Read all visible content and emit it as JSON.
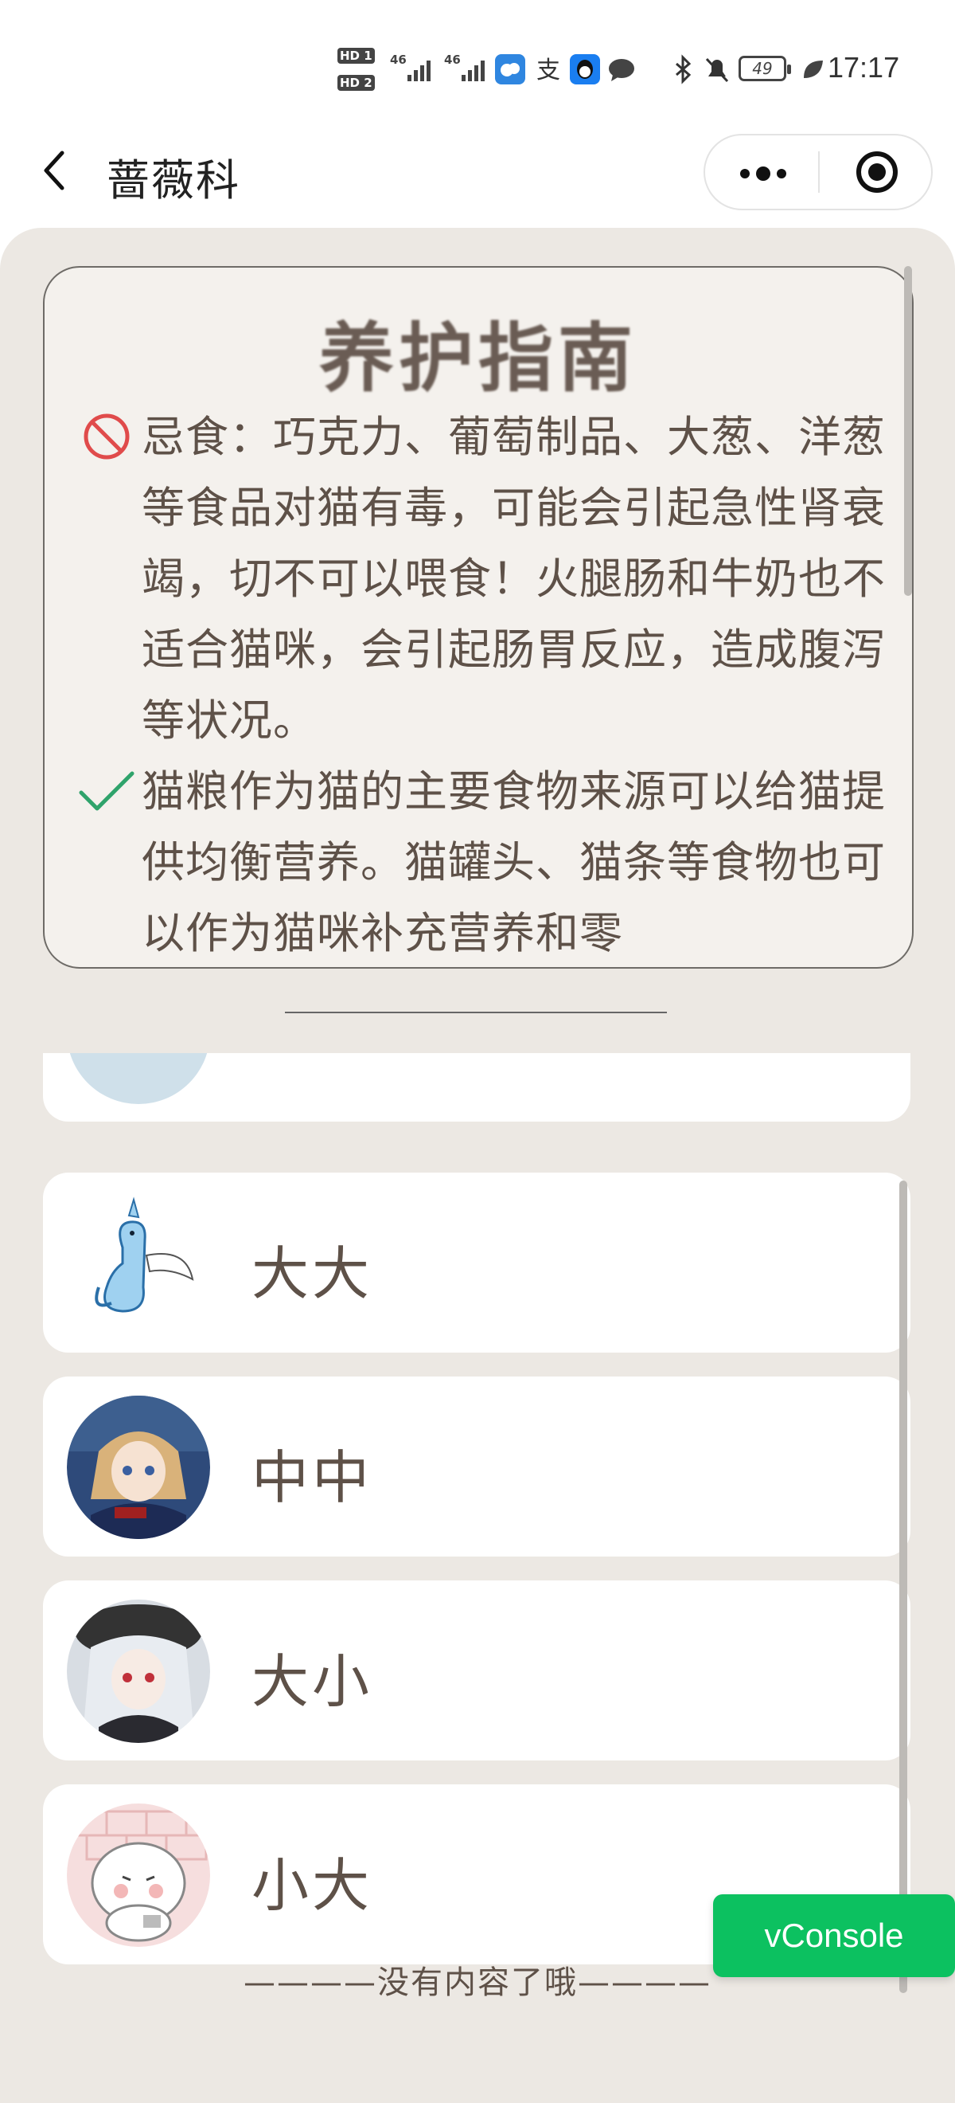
{
  "status_bar": {
    "time": "17:17",
    "battery": "49",
    "sim1": "HD 1",
    "sim2": "HD 2",
    "network1": "46",
    "network2": "46",
    "icons": [
      "weather-app-icon",
      "alipay-icon",
      "qq-icon",
      "chat-bubble-icon",
      "bluetooth-icon",
      "mute-bell-icon",
      "leaf-icon"
    ]
  },
  "nav": {
    "title": "蔷薇科"
  },
  "guide": {
    "title": "养护指南",
    "warning_text": "忌食：巧克力、葡萄制品、大葱、洋葱等食品对猫有毒，可能会引起急性肾衰竭，切不可以喂食！火腿肠和牛奶也不适合猫咪，会引起肠胃反应，造成腹泻等状况。",
    "recommend_text": "猫粮作为猫的主要食物来源可以给猫提供均衡营养。猫罐头、猫条等食物也可以作为猫咪补充营养和零"
  },
  "pets": [
    {
      "name": "大大",
      "avatar": "blue-dragon-avatar"
    },
    {
      "name": "中中",
      "avatar": "anime-girl-blonde-avatar"
    },
    {
      "name": "大小",
      "avatar": "anime-girl-silver-avatar"
    },
    {
      "name": "小大",
      "avatar": "white-sheep-avatar"
    }
  ],
  "end_text": "————没有内容了哦————",
  "vconsole_label": "vConsole",
  "colors": {
    "background": "#ece8e3",
    "text": "#5e5148",
    "warning": "#e04b4b",
    "check": "#2fa36b",
    "vconsole": "#0cc160"
  }
}
